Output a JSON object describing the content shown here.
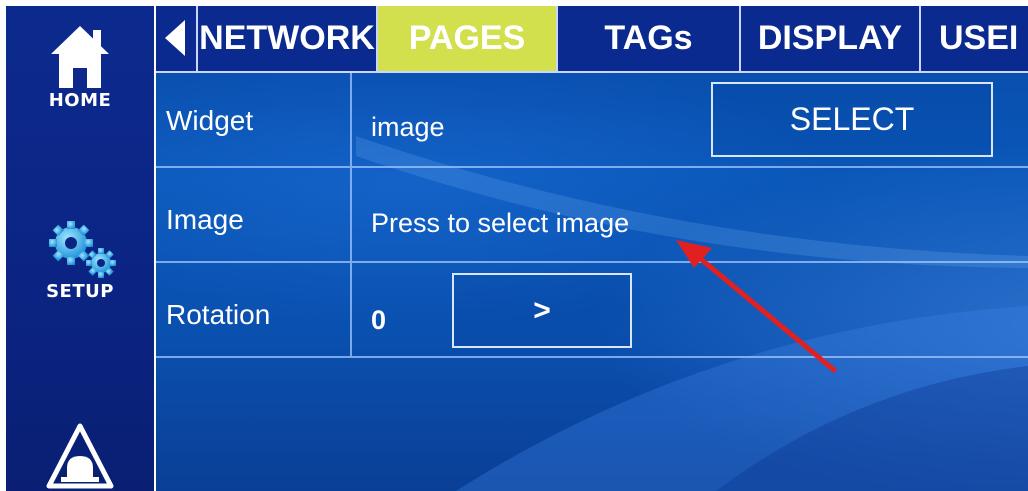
{
  "sidebar": {
    "home_label": "HOME",
    "setup_label": "SETUP",
    "icons": [
      "home-icon",
      "gears-icon",
      "alarm-icon"
    ]
  },
  "tabs": {
    "back_icon": "back-arrow-icon",
    "items": [
      {
        "label": "NETWORK",
        "active": false
      },
      {
        "label": "PAGES",
        "active": true
      },
      {
        "label": "TAGs",
        "active": false
      },
      {
        "label": "DISPLAY",
        "active": false
      },
      {
        "label": "USEI",
        "active": false
      }
    ],
    "active_color": "#d3e04e"
  },
  "rows": {
    "widget": {
      "name": "Widget",
      "value": "image",
      "button_label": "SELECT"
    },
    "image": {
      "name": "Image",
      "value": "Press to select image"
    },
    "rotation": {
      "name": "Rotation",
      "value": "0",
      "button_label": ">"
    }
  },
  "colors": {
    "sidebar_bg": "#0b2483",
    "tabbar_bg": "#0b2a8f",
    "main_bg": "#0957b8",
    "annotation_arrow": "#e32020"
  }
}
